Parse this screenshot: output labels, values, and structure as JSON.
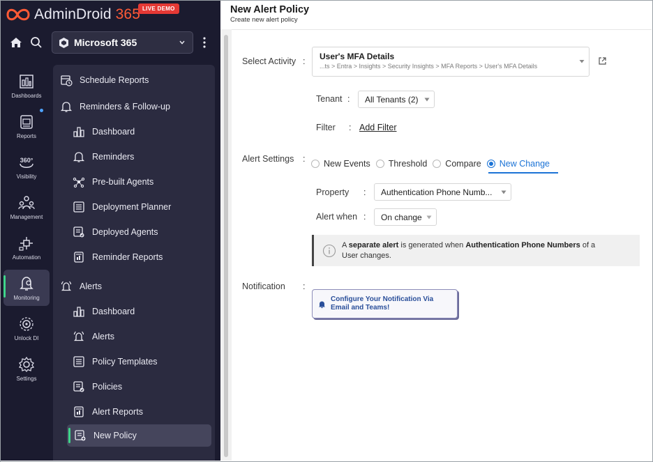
{
  "brand": {
    "name_prefix": "AdminDroid",
    "name_suffix": "365",
    "badge": "LIVE DEMO"
  },
  "topbar": {
    "tenant": "Microsoft 365"
  },
  "rail": [
    {
      "label": "Dashboards",
      "icon": "dashboards-icon"
    },
    {
      "label": "Reports",
      "icon": "reports-icon"
    },
    {
      "label": "Visibility",
      "icon": "visibility-360-icon"
    },
    {
      "label": "Management",
      "icon": "management-icon"
    },
    {
      "label": "Automation",
      "icon": "automation-icon"
    },
    {
      "label": "Monitoring",
      "icon": "monitoring-icon",
      "active": true
    },
    {
      "label": "Unlock DI",
      "icon": "unlock-di-icon"
    },
    {
      "label": "Settings",
      "icon": "settings-icon"
    }
  ],
  "menu": {
    "schedule_reports": "Schedule Reports",
    "reminders_followup": "Reminders & Follow-up",
    "r_dashboard": "Dashboard",
    "r_reminders": "Reminders",
    "r_prebuilt": "Pre-built Agents",
    "r_deployment": "Deployment Planner",
    "r_deployed": "Deployed Agents",
    "r_reports": "Reminder Reports",
    "alerts": "Alerts",
    "a_dashboard": "Dashboard",
    "a_alerts": "Alerts",
    "a_templates": "Policy Templates",
    "a_policies": "Policies",
    "a_reports": "Alert Reports",
    "a_new_policy": "New Policy"
  },
  "page": {
    "title": "New Alert Policy",
    "subtitle": "Create new alert policy"
  },
  "form": {
    "select_activity_label": "Select Activity",
    "colon": ":",
    "activity_name": "User's MFA Details",
    "activity_path": "...ts > Entra > Insights > Security Insights > MFA Reports > User's MFA Details",
    "tenant_label": "Tenant",
    "tenant_value": "All Tenants (2)",
    "filter_label": "Filter",
    "filter_link": "Add Filter",
    "alert_settings_label": "Alert Settings",
    "radios": [
      "New Events",
      "Threshold",
      "Compare",
      "New Change"
    ],
    "property_label": "Property",
    "property_value": "Authentication Phone Numb...",
    "alert_when_label": "Alert when",
    "alert_when_value": "On change",
    "info_pre": "A ",
    "info_bold1": "separate alert",
    "info_mid": " is generated when ",
    "info_bold2": "Authentication Phone Numbers",
    "info_post": " of a",
    "info_line2": "User changes.",
    "notification_label": "Notification",
    "notif_line1": "Configure Your Notification Via",
    "notif_line2": "Email and Teams!"
  },
  "colors": {
    "accent_blue": "#1b73d6",
    "active_green": "#3fd48a",
    "brand_orange": "#ff5a36",
    "sidebar_bg": "#1b1b2f"
  }
}
